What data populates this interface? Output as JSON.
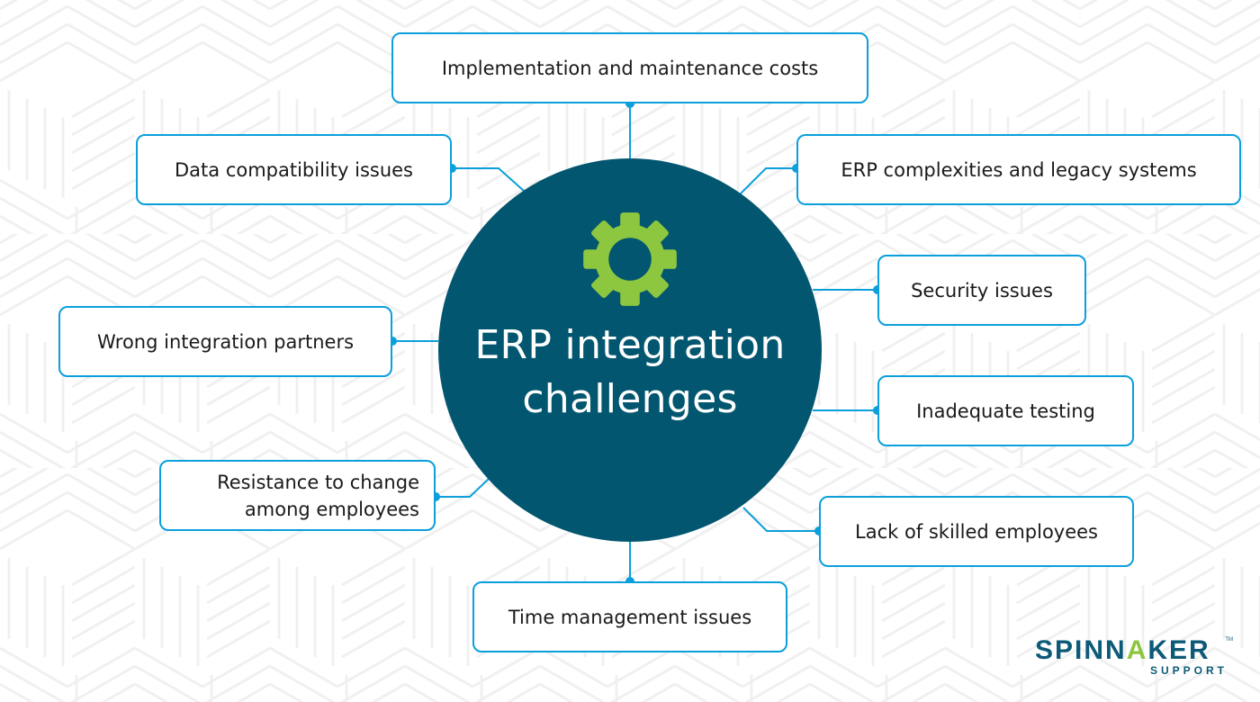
{
  "diagram": {
    "title_line1": "ERP integration",
    "title_line2": "challenges",
    "center_icon": "gear-icon",
    "colors": {
      "hub": "#02566f",
      "gear": "#8dc63f",
      "connector": "#0b9fdc",
      "node_border": "#0b9fdc",
      "node_text": "#1a1a1a"
    },
    "nodes": [
      {
        "id": "implementation-costs",
        "label": "Implementation and maintenance costs"
      },
      {
        "id": "data-compatibility",
        "label": "Data compatibility issues"
      },
      {
        "id": "erp-complexities",
        "label": "ERP complexities and legacy systems"
      },
      {
        "id": "security",
        "label": "Security issues"
      },
      {
        "id": "wrong-partners",
        "label": "Wrong integration partners"
      },
      {
        "id": "inadequate-testing",
        "label": "Inadequate testing"
      },
      {
        "id": "resistance-to-change",
        "label_line1": "Resistance to change",
        "label_line2": "among employees"
      },
      {
        "id": "lack-of-skills",
        "label": "Lack of skilled employees"
      },
      {
        "id": "time-management",
        "label": "Time management issues"
      }
    ]
  },
  "logo": {
    "brand_part1": "SPINN",
    "brand_accent": "A",
    "brand_part2": "KER",
    "tagline": "SUPPORT",
    "trademark": "TM"
  }
}
